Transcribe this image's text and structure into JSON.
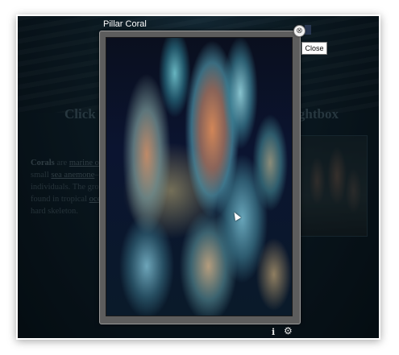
{
  "background_page": {
    "heading_left": "Click o",
    "heading_right": "ghtbox",
    "paragraph_lines": [
      [
        "Corals",
        " are ",
        "marine oi",
        ""
      ],
      [
        "small ",
        "sea anemone",
        "–l",
        ""
      ],
      [
        "individuals. The grou",
        "",
        "",
        ""
      ],
      [
        "found in tropical ",
        "oce",
        "",
        ""
      ],
      [
        "hard skeleton.",
        "",
        "",
        ""
      ]
    ]
  },
  "lightbox": {
    "title": "Pillar Coral",
    "close_symbol": "⊗",
    "close_tooltip": "Close",
    "info_symbol": "i",
    "settings_symbol": "⚙",
    "image_subject": "pillar-coral"
  },
  "colors": {
    "overlay": "#000000",
    "frame": "#5d5d5d"
  }
}
